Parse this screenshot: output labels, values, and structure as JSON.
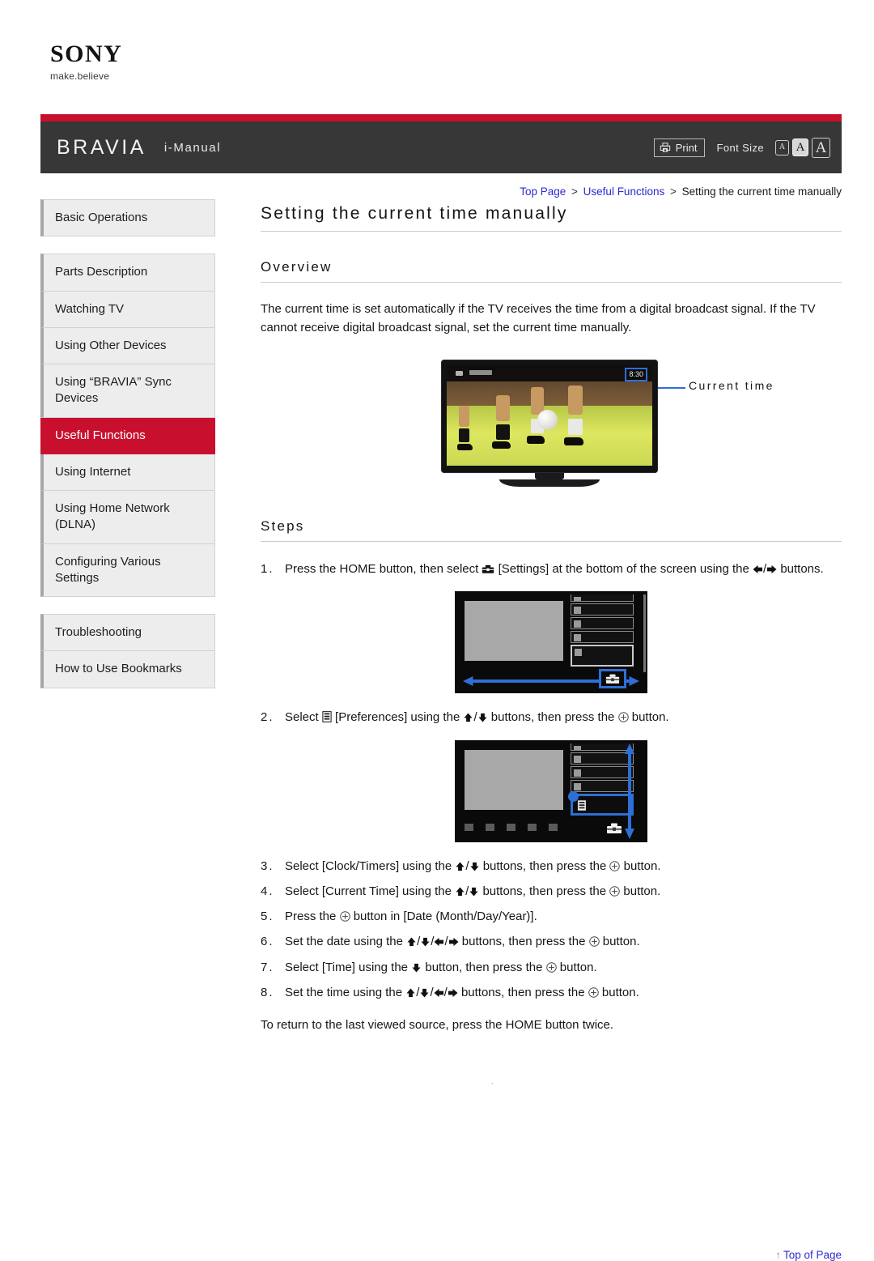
{
  "brand": {
    "logo_text": "SONY",
    "tagline": "make.believe"
  },
  "header": {
    "product": "BRAVIA",
    "manual_label": "i-Manual",
    "print_label": "Print",
    "print_icon": "printer-icon",
    "font_size_label": "Font Size",
    "font_size_options": [
      {
        "label": "A",
        "size": "small",
        "selected": false
      },
      {
        "label": "A",
        "size": "medium",
        "selected": true
      },
      {
        "label": "A",
        "size": "large",
        "selected": false
      }
    ],
    "accent_color": "#c8102e",
    "bar_color": "#373737"
  },
  "breadcrumb": {
    "items": [
      {
        "label": "Top Page",
        "link": true
      },
      {
        "label": "Useful Functions",
        "link": true
      },
      {
        "label": "Setting the current time manually",
        "link": false
      }
    ],
    "separator": ">"
  },
  "sidebar": {
    "groups": [
      {
        "items": [
          {
            "label": "Basic Operations",
            "active": false
          }
        ]
      },
      {
        "items": [
          {
            "label": "Parts Description",
            "active": false
          },
          {
            "label": "Watching TV",
            "active": false
          },
          {
            "label": "Using Other Devices",
            "active": false
          },
          {
            "label": "Using “BRAVIA” Sync Devices",
            "active": false
          },
          {
            "label": "Useful Functions",
            "active": true
          },
          {
            "label": "Using Internet",
            "active": false
          },
          {
            "label": "Using Home Network (DLNA)",
            "active": false
          },
          {
            "label": "Configuring Various Settings",
            "active": false
          }
        ]
      },
      {
        "items": [
          {
            "label": "Troubleshooting",
            "active": false
          },
          {
            "label": "How to Use Bookmarks",
            "active": false
          }
        ]
      }
    ]
  },
  "main": {
    "page_title": "Setting the current time manually",
    "overview": {
      "heading": "Overview",
      "paragraph": "The current time is set automatically if the TV receives the time from a digital broadcast signal. If the TV cannot receive digital broadcast signal, set the current time manually."
    },
    "tv_figure": {
      "clock_value": "8:30",
      "callout_label": "Current time",
      "callout_color": "#2e6fd6"
    },
    "steps_heading": "Steps",
    "steps": [
      {
        "number": "1.",
        "parts": [
          {
            "t": "text",
            "v": "Press the HOME button, then select "
          },
          {
            "t": "icon",
            "v": "toolbox-icon"
          },
          {
            "t": "text",
            "v": " [Settings] at the bottom of the screen using the "
          },
          {
            "t": "icon",
            "v": "arrow-left-icon"
          },
          {
            "t": "text",
            "v": "/"
          },
          {
            "t": "icon",
            "v": "arrow-right-icon"
          },
          {
            "t": "text",
            "v": " buttons."
          }
        ]
      },
      {
        "number": "2.",
        "parts": [
          {
            "t": "text",
            "v": "Select "
          },
          {
            "t": "icon",
            "v": "preferences-icon"
          },
          {
            "t": "text",
            "v": " [Preferences] using the "
          },
          {
            "t": "icon",
            "v": "arrow-up-icon"
          },
          {
            "t": "text",
            "v": "/"
          },
          {
            "t": "icon",
            "v": "arrow-down-icon"
          },
          {
            "t": "text",
            "v": " buttons, then press the "
          },
          {
            "t": "icon",
            "v": "enter-icon"
          },
          {
            "t": "text",
            "v": " button."
          }
        ]
      },
      {
        "number": "3.",
        "parts": [
          {
            "t": "text",
            "v": "Select [Clock/Timers] using the "
          },
          {
            "t": "icon",
            "v": "arrow-up-icon"
          },
          {
            "t": "text",
            "v": "/"
          },
          {
            "t": "icon",
            "v": "arrow-down-icon"
          },
          {
            "t": "text",
            "v": " buttons, then press the "
          },
          {
            "t": "icon",
            "v": "enter-icon"
          },
          {
            "t": "text",
            "v": " button."
          }
        ]
      },
      {
        "number": "4.",
        "parts": [
          {
            "t": "text",
            "v": "Select [Current Time] using the "
          },
          {
            "t": "icon",
            "v": "arrow-up-icon"
          },
          {
            "t": "text",
            "v": "/"
          },
          {
            "t": "icon",
            "v": "arrow-down-icon"
          },
          {
            "t": "text",
            "v": " buttons, then press the "
          },
          {
            "t": "icon",
            "v": "enter-icon"
          },
          {
            "t": "text",
            "v": " button."
          }
        ]
      },
      {
        "number": "5.",
        "parts": [
          {
            "t": "text",
            "v": "Press the "
          },
          {
            "t": "icon",
            "v": "enter-icon"
          },
          {
            "t": "text",
            "v": " button in [Date (Month/Day/Year)]."
          }
        ]
      },
      {
        "number": "6.",
        "parts": [
          {
            "t": "text",
            "v": "Set the date using the "
          },
          {
            "t": "icon",
            "v": "arrow-up-icon"
          },
          {
            "t": "text",
            "v": "/"
          },
          {
            "t": "icon",
            "v": "arrow-down-icon"
          },
          {
            "t": "text",
            "v": "/"
          },
          {
            "t": "icon",
            "v": "arrow-left-icon"
          },
          {
            "t": "text",
            "v": "/"
          },
          {
            "t": "icon",
            "v": "arrow-right-icon"
          },
          {
            "t": "text",
            "v": " buttons, then press the "
          },
          {
            "t": "icon",
            "v": "enter-icon"
          },
          {
            "t": "text",
            "v": " button."
          }
        ]
      },
      {
        "number": "7.",
        "parts": [
          {
            "t": "text",
            "v": "Select [Time] using the "
          },
          {
            "t": "icon",
            "v": "arrow-down-icon"
          },
          {
            "t": "text",
            "v": " button, then press the "
          },
          {
            "t": "icon",
            "v": "enter-icon"
          },
          {
            "t": "text",
            "v": " button."
          }
        ]
      },
      {
        "number": "8.",
        "parts": [
          {
            "t": "text",
            "v": "Set the time using the "
          },
          {
            "t": "icon",
            "v": "arrow-up-icon"
          },
          {
            "t": "text",
            "v": "/"
          },
          {
            "t": "icon",
            "v": "arrow-down-icon"
          },
          {
            "t": "text",
            "v": "/"
          },
          {
            "t": "icon",
            "v": "arrow-left-icon"
          },
          {
            "t": "text",
            "v": "/"
          },
          {
            "t": "icon",
            "v": "arrow-right-icon"
          },
          {
            "t": "text",
            "v": " buttons, then press the "
          },
          {
            "t": "icon",
            "v": "enter-icon"
          },
          {
            "t": "text",
            "v": " button."
          }
        ]
      }
    ],
    "closing_note": "To return to the last viewed source, press the HOME button twice."
  },
  "footer": {
    "top_of_page_label": "Top of Page",
    "top_of_page_arrow": "↑"
  }
}
